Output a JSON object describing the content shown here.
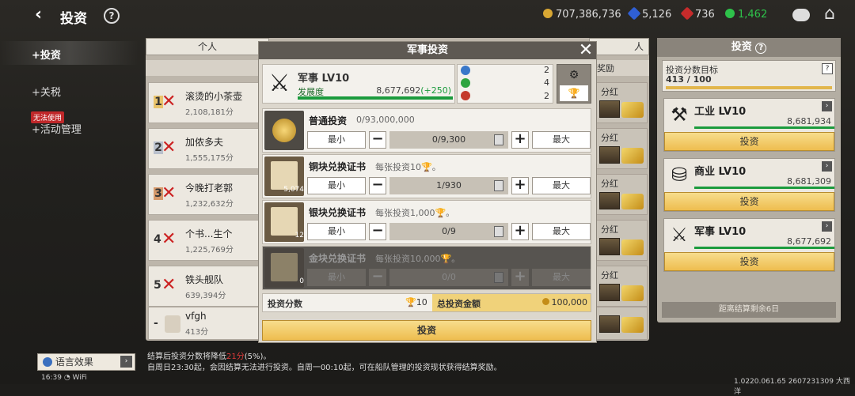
{
  "topbar": {
    "title": "投资",
    "help": "?",
    "gold": "707,386,736",
    "gem_blue": "5,126",
    "gem_red": "736",
    "green_gear": "1,462"
  },
  "nav": {
    "items": [
      {
        "label": "投资"
      },
      {
        "label": "关税"
      },
      {
        "label": "活动管理"
      }
    ],
    "badge": "无法使用",
    "lang_button": "语言效果"
  },
  "status": {
    "time": "16:39",
    "wifi": "WiFi",
    "version": "1.0220.061.65 2607231309 大西洋"
  },
  "ranking": {
    "tabs": [
      "个人",
      "人"
    ],
    "reward_header": "奖励",
    "rows": [
      {
        "rank": "1",
        "name": "滚烫的小茶壶",
        "score": "2,108,181分"
      },
      {
        "rank": "2",
        "name": "加侬多夫",
        "score": "1,555,175分"
      },
      {
        "rank": "3",
        "name": "今晚打老郭",
        "score": "1,232,632分"
      },
      {
        "rank": "4",
        "name": "个书...生个",
        "score": "1,225,769分"
      },
      {
        "rank": "5",
        "name": "铁头舰队",
        "score": "639,394分"
      },
      {
        "rank": "-",
        "name": "vfgh",
        "score": "413分"
      }
    ],
    "reward_label": "分红",
    "notice_line1": "结算后投资分数将降低",
    "notice_red": "21分",
    "notice_line1_end": "(5%)。",
    "notice_line2": "自周日23:30起，会因结算无法进行投资。自周一00:10起，可在船队管理的投资现状获得结算奖励。"
  },
  "right_panel": {
    "title": "投资",
    "target_label": "投资分数目标",
    "target_value": "413 / 100",
    "target_help": "?",
    "cards": [
      {
        "name": "工业 LV10",
        "value": "8,681,934",
        "button": "投资"
      },
      {
        "name": "商业 LV10",
        "value": "8,681,309",
        "button": "投资"
      },
      {
        "name": "军事 LV10",
        "value": "8,677,692",
        "button": "投资"
      }
    ],
    "settle_label": "距离结算剩余6日"
  },
  "modal": {
    "title": "军事投资",
    "close": "✕",
    "header_name": "军事 LV10",
    "dev_label": "发展度",
    "dev_value": "8,677,692",
    "dev_plus": "(+250)",
    "dev_progress": 1.0,
    "tiers": [
      "2",
      "4",
      "2"
    ],
    "rows": [
      {
        "name": "普通投资",
        "desc": "0/93,000,000",
        "min": "最小",
        "max": "最大",
        "qty": "0/9,300",
        "minus": "−",
        "plus": "+",
        "count": ""
      },
      {
        "name": "铜块兑换证书",
        "desc": "每张投资10🏆。",
        "min": "最小",
        "max": "最大",
        "qty": "1/930",
        "minus": "−",
        "plus": "+",
        "count": "5,074"
      },
      {
        "name": "银块兑换证书",
        "desc": "每张投资1,000🏆。",
        "min": "最小",
        "max": "最大",
        "qty": "0/9",
        "minus": "−",
        "plus": "+",
        "count": "12"
      },
      {
        "name": "金块兑换证书",
        "desc": "每张投资10,000🏆。",
        "min": "最小",
        "max": "最大",
        "qty": "0/0",
        "minus": "−",
        "plus": "+",
        "count": "0"
      }
    ],
    "score_label": "投资分数",
    "score_value": "10",
    "total_label": "总投资金额",
    "total_value": "100,000",
    "invest_button": "投资"
  }
}
